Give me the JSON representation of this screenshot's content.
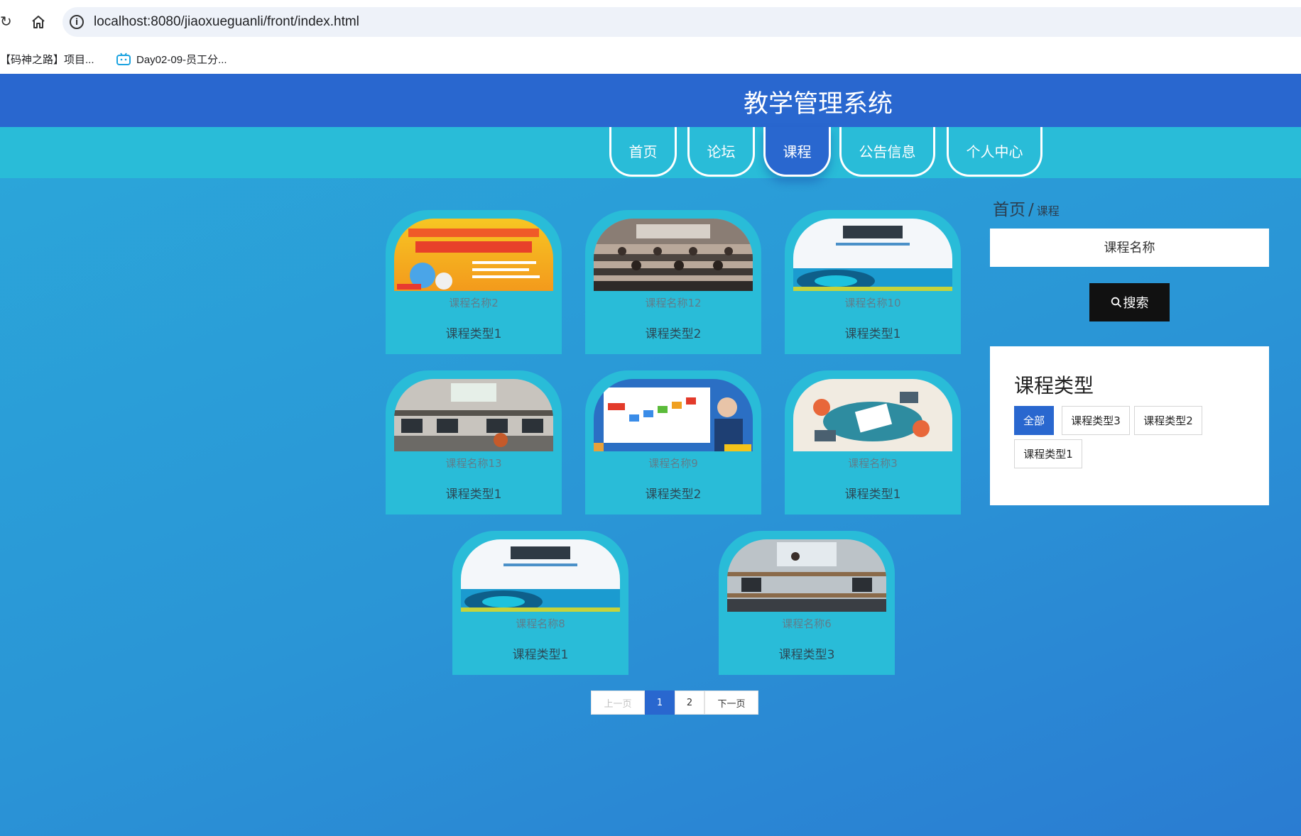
{
  "browser": {
    "url": "localhost:8080/jiaoxueguanli/front/index.html",
    "bookmarks": [
      "【码神之路】项目...",
      "Day02-09-员工分..."
    ]
  },
  "header": {
    "title": "教学管理系统"
  },
  "nav": {
    "items": [
      "首页",
      "论坛",
      "课程",
      "公告信息",
      "个人中心"
    ],
    "active": "课程"
  },
  "courses": [
    {
      "name": "课程名称2",
      "type": "课程类型1",
      "image": "textbook-network-cover"
    },
    {
      "name": "课程名称12",
      "type": "课程类型2",
      "image": "classroom-photo"
    },
    {
      "name": "课程名称10",
      "type": "课程类型1",
      "image": "physics-book-cover"
    },
    {
      "name": "课程名称13",
      "type": "课程类型1",
      "image": "computer-lab-photo"
    },
    {
      "name": "课程名称9",
      "type": "课程类型2",
      "image": "lecture-slide-teacher"
    },
    {
      "name": "课程名称3",
      "type": "课程类型1",
      "image": "creative-team-illustration"
    },
    {
      "name": "课程名称8",
      "type": "课程类型1",
      "image": "physics-book-cover"
    },
    {
      "name": "课程名称6",
      "type": "课程类型3",
      "image": "lab-classroom-photo"
    }
  ],
  "pagination": {
    "prev": "上一页",
    "pages": [
      "1",
      "2"
    ],
    "current": "1",
    "next": "下一页"
  },
  "sidebar": {
    "breadcrumb": {
      "home": "首页",
      "separator": "/",
      "current": "课程"
    },
    "search": {
      "placeholder": "课程名称",
      "button": "搜索"
    },
    "type_filter": {
      "title": "课程类型",
      "options": [
        "全部",
        "课程类型3",
        "课程类型2",
        "课程类型1"
      ],
      "active": "全部"
    }
  },
  "colors": {
    "header": "#2967cf",
    "nav_strip": "#29bcd8",
    "card": "#29bcd8",
    "active": "#2967cf"
  }
}
